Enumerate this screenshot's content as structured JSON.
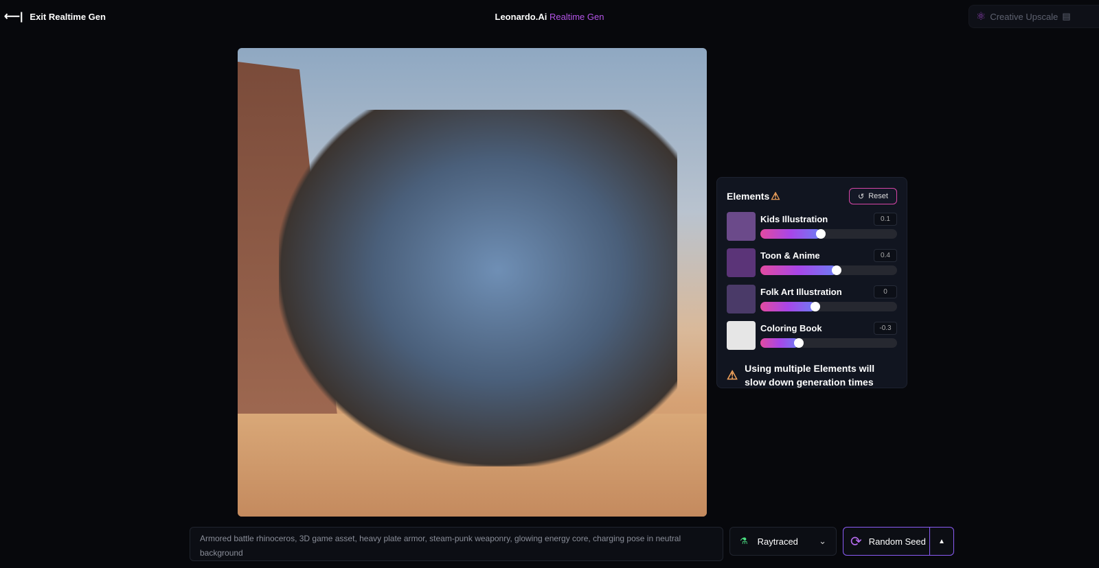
{
  "header": {
    "exit_label": "Exit Realtime Gen",
    "brand": "Leonardo.Ai",
    "mode": "Realtime Gen",
    "upscale_label": "Creative Upscale"
  },
  "elements": {
    "title": "Elements",
    "reset_label": "Reset",
    "items": [
      {
        "name": "Kids Illustration",
        "value": "0.1",
        "slider_fraction": 0.44,
        "thumb": "#6b4a8a"
      },
      {
        "name": "Toon & Anime",
        "value": "0.4",
        "slider_fraction": 0.56,
        "thumb": "#5b3478"
      },
      {
        "name": "Folk Art Illustration",
        "value": "0",
        "slider_fraction": 0.4,
        "thumb": "#4a3a68"
      },
      {
        "name": "Coloring Book",
        "value": "-0.3",
        "slider_fraction": 0.28,
        "thumb": "#e6e6e6"
      }
    ],
    "warning": "Using multiple Elements will slow down generation times"
  },
  "prompt": {
    "value": "Armored battle rhinoceros, 3D game asset, heavy plate armor, steam-punk weaponry, glowing energy core, charging pose in neutral background"
  },
  "model": {
    "selected": "Raytraced"
  },
  "seed": {
    "label": "Random Seed"
  },
  "colors": {
    "accent": "#b455e8",
    "warning": "#f4a45c"
  }
}
